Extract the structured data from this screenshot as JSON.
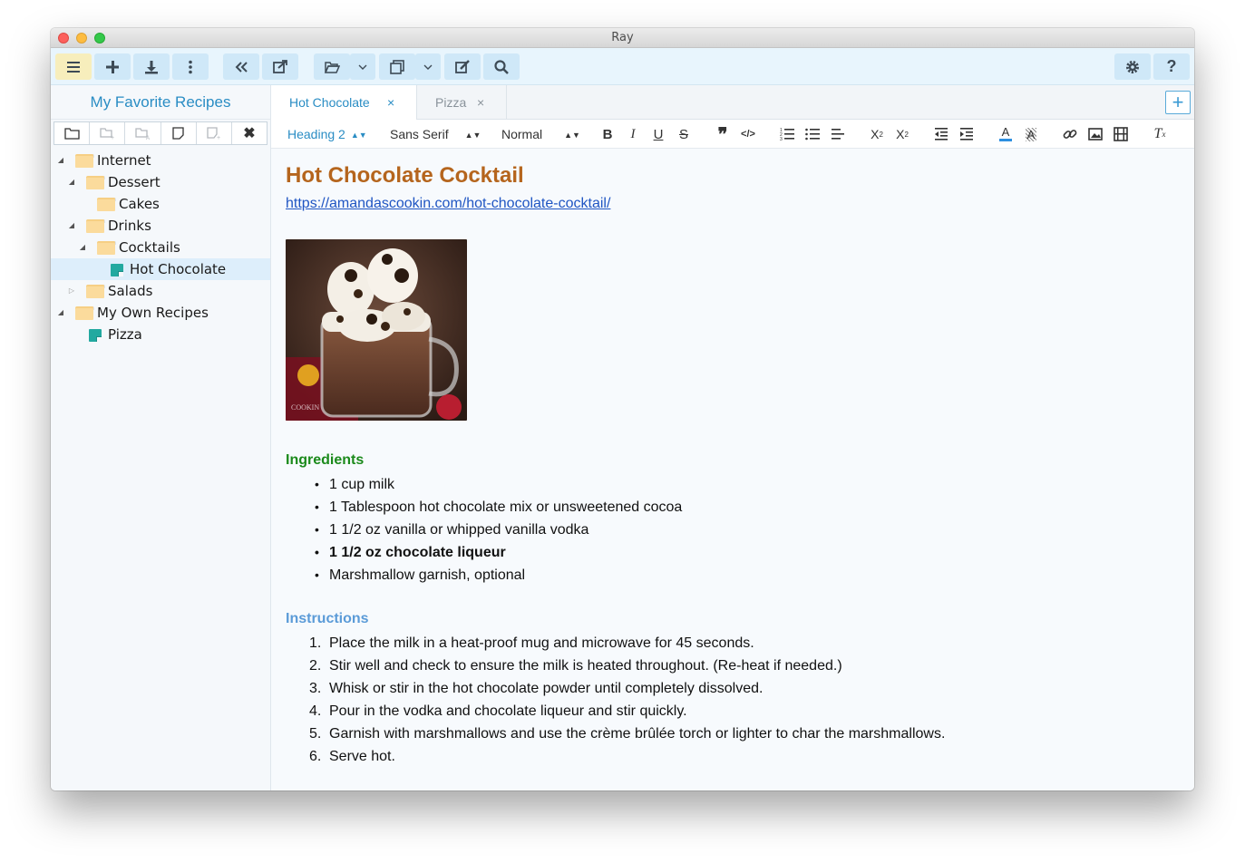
{
  "window": {
    "title": "Ray"
  },
  "sidebar": {
    "title": "My Favorite Recipes",
    "tree": [
      {
        "label": "Internet",
        "type": "folder",
        "level": 0,
        "expanded": true
      },
      {
        "label": "Dessert",
        "type": "folder",
        "level": 1,
        "expanded": true
      },
      {
        "label": "Cakes",
        "type": "folder",
        "level": 2
      },
      {
        "label": "Drinks",
        "type": "folder",
        "level": 1,
        "expanded": true
      },
      {
        "label": "Cocktails",
        "type": "folder",
        "level": 2,
        "expanded": true
      },
      {
        "label": "Hot Chocolate",
        "type": "note",
        "level": 3,
        "selected": true
      },
      {
        "label": "Salads",
        "type": "folder",
        "level": 1,
        "expanded": false
      },
      {
        "label": "My Own Recipes",
        "type": "folder",
        "level": 0,
        "expanded": true
      },
      {
        "label": "Pizza",
        "type": "note",
        "level": 1
      }
    ]
  },
  "tabs": [
    {
      "label": "Hot Chocolate",
      "active": true
    },
    {
      "label": "Pizza",
      "active": false
    }
  ],
  "format_bar": {
    "heading": "Heading 2",
    "font": "Sans Serif",
    "size": "Normal"
  },
  "document": {
    "title": "Hot Chocolate Cocktail",
    "link": "https://amandascookin.com/hot-chocolate-cocktail/",
    "ingredients_heading": "Ingredients",
    "ingredients": [
      {
        "text": "1 cup milk",
        "bold": false
      },
      {
        "text": "1 Tablespoon hot chocolate mix or unsweetened cocoa",
        "bold": false
      },
      {
        "text": "1 1/2 oz vanilla or whipped vanilla vodka",
        "bold": false
      },
      {
        "text": "1 1/2 oz chocolate liqueur",
        "bold": true
      },
      {
        "text": "Marshmallow garnish, optional",
        "bold": false
      }
    ],
    "instructions_heading": "Instructions",
    "instructions": [
      "Place the milk in a heat-proof mug and microwave for 45 seconds.",
      "Stir well and check to ensure the milk is heated throughout. (Re-heat if needed.)",
      "Whisk or stir in the hot chocolate powder until completely dissolved.",
      "Pour in the vodka and chocolate liqueur and stir quickly.",
      "Garnish with marshmallows and use the crème brûlée torch or lighter to char the marshmallows.",
      "Serve hot."
    ]
  },
  "colors": {
    "title_accent": "#b5651d",
    "link": "#1f55c3",
    "ingredients_heading": "#1b8a1b",
    "instructions_heading": "#5b9bd8",
    "ui_accent": "#2a8dc4"
  }
}
